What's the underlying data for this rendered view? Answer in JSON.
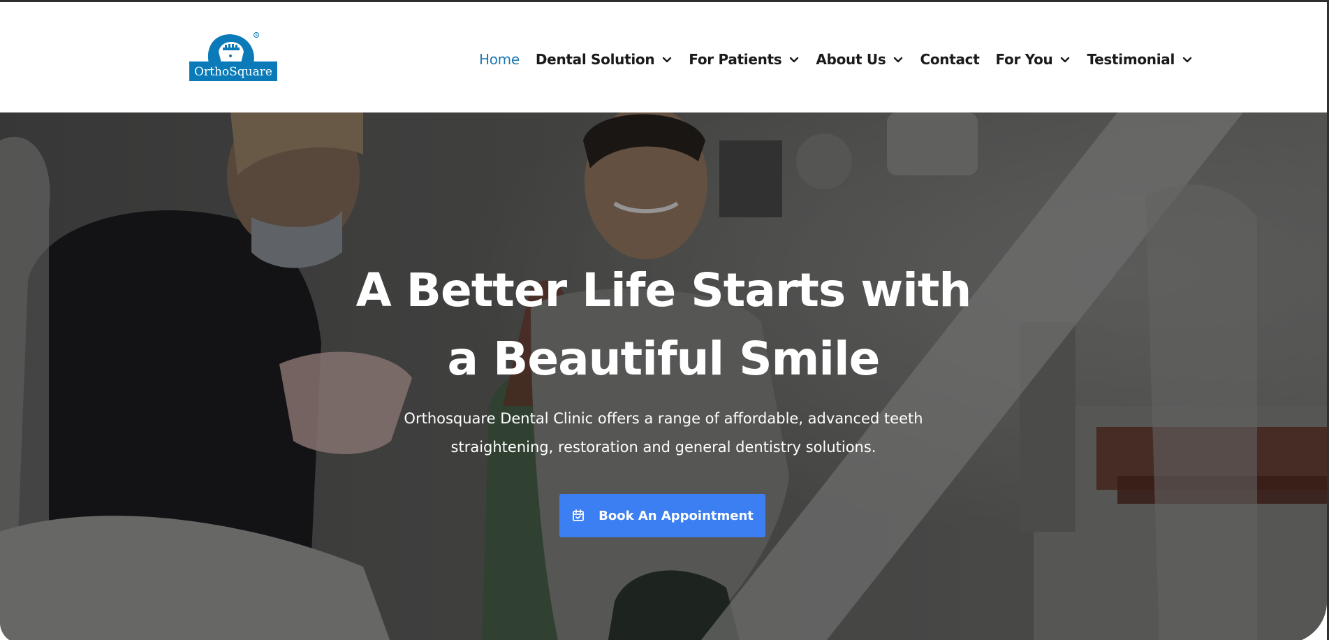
{
  "brand": {
    "logo_text": "OrthoSquare",
    "logo_color": "#0a7bb8"
  },
  "nav": {
    "items": [
      {
        "label": "Home",
        "active": true,
        "dropdown": false
      },
      {
        "label": "Dental Solution",
        "active": false,
        "dropdown": true
      },
      {
        "label": "For Patients",
        "active": false,
        "dropdown": true
      },
      {
        "label": "About Us",
        "active": false,
        "dropdown": true
      },
      {
        "label": "Contact",
        "active": false,
        "dropdown": false
      },
      {
        "label": "For You",
        "active": false,
        "dropdown": true
      },
      {
        "label": "Testimonial",
        "active": false,
        "dropdown": true
      }
    ],
    "active_color": "#1e78b4"
  },
  "hero": {
    "title_line1": "A Better Life Starts with",
    "title_line2": "a Beautiful Smile",
    "subtitle_line1": "Orthosquare Dental Clinic offers a range of affordable, advanced teeth",
    "subtitle_line2": "straightening, restoration and general dentistry solutions.",
    "cta_label": "Book An Appointment",
    "cta_icon": "calendar-check-icon",
    "cta_color": "#3b7ff2",
    "background_description_colors": [
      "#4a4a4a",
      "#2a2a2a",
      "#8a8a8a"
    ]
  }
}
